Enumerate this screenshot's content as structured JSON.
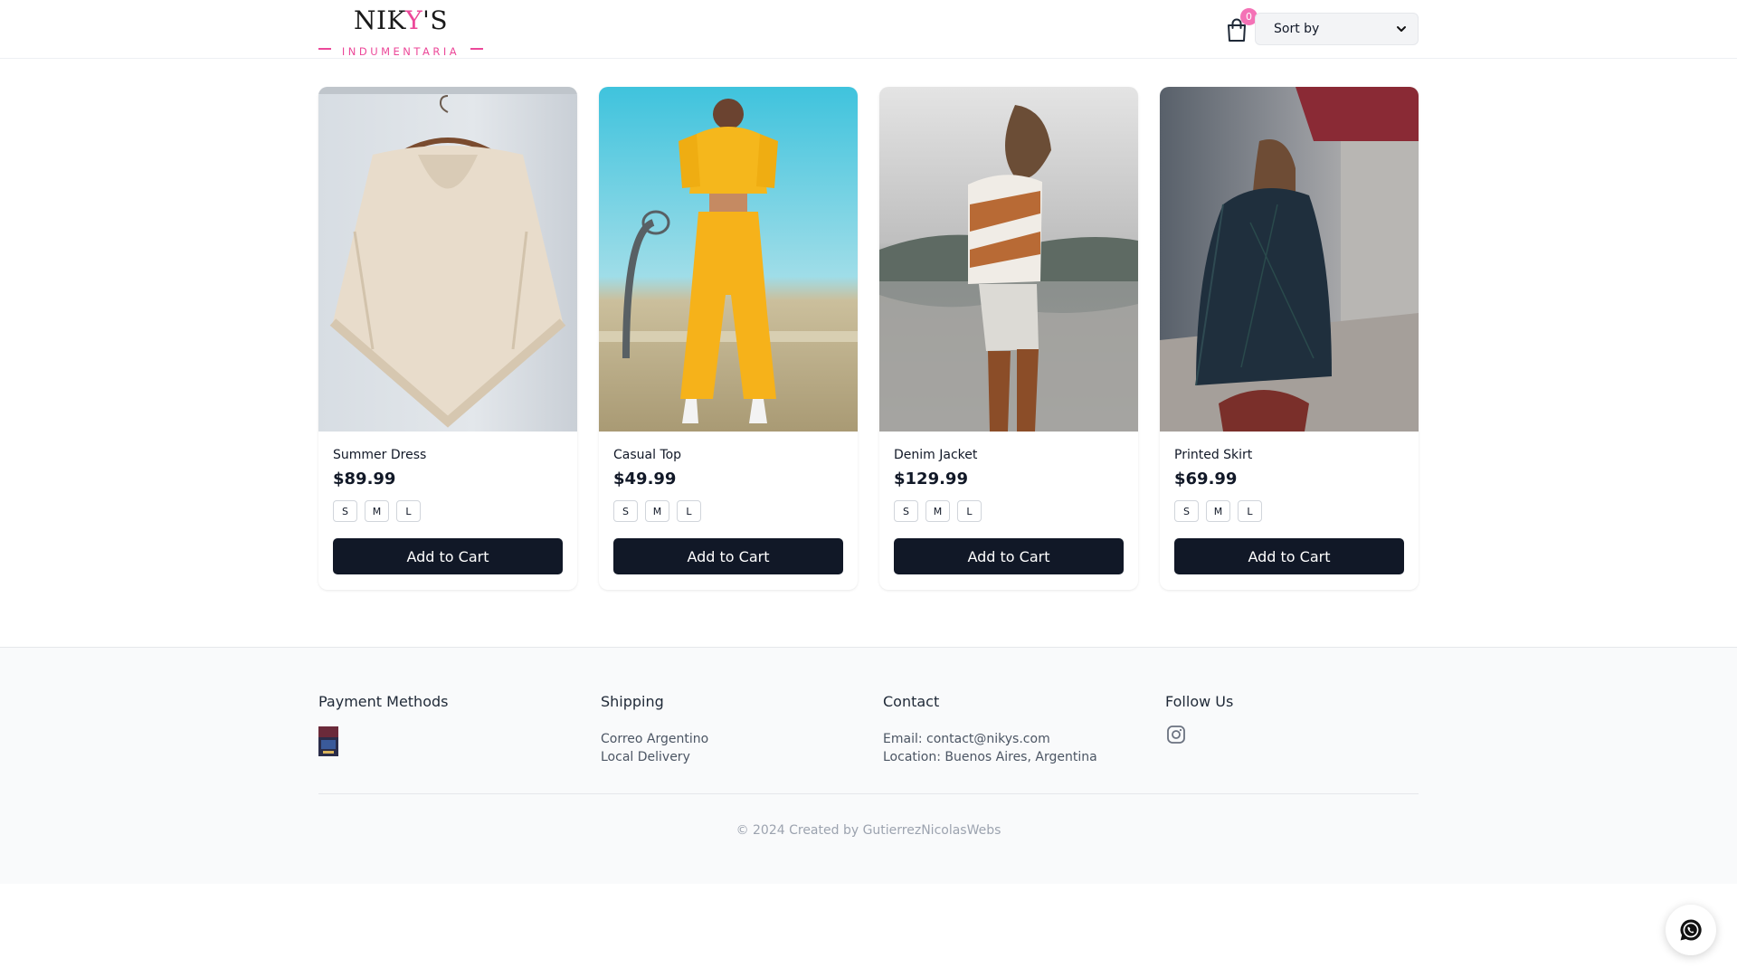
{
  "brand": {
    "name_part1": "NIK",
    "name_accent": "Y",
    "name_part2": "'S",
    "subtitle": "INDUMENTARIA",
    "accent_color": "#ec4899"
  },
  "header": {
    "cart_count": "0",
    "sort_label": "Sort by"
  },
  "products": [
    {
      "name": "Summer Dress",
      "price": "$89.99",
      "sizes": [
        "S",
        "M",
        "L"
      ],
      "button": "Add to Cart"
    },
    {
      "name": "Casual Top",
      "price": "$49.99",
      "sizes": [
        "S",
        "M",
        "L"
      ],
      "button": "Add to Cart"
    },
    {
      "name": "Denim Jacket",
      "price": "$129.99",
      "sizes": [
        "S",
        "M",
        "L"
      ],
      "button": "Add to Cart"
    },
    {
      "name": "Printed Skirt",
      "price": "$69.99",
      "sizes": [
        "S",
        "M",
        "L"
      ],
      "button": "Add to Cart"
    }
  ],
  "footer": {
    "payment": {
      "title": "Payment Methods"
    },
    "shipping": {
      "title": "Shipping",
      "items": [
        "Correo Argentino",
        "Local Delivery"
      ]
    },
    "contact": {
      "title": "Contact",
      "email": "Email: contact@nikys.com",
      "location": "Location: Buenos Aires, Argentina"
    },
    "follow": {
      "title": "Follow Us"
    },
    "copyright": "© 2024 Created by GutierrezNicolasWebs"
  },
  "icons": {
    "cart": "shopping-bag-icon",
    "sort": "chevron-down-icon",
    "instagram": "instagram-icon",
    "whatsapp": "whatsapp-icon"
  }
}
